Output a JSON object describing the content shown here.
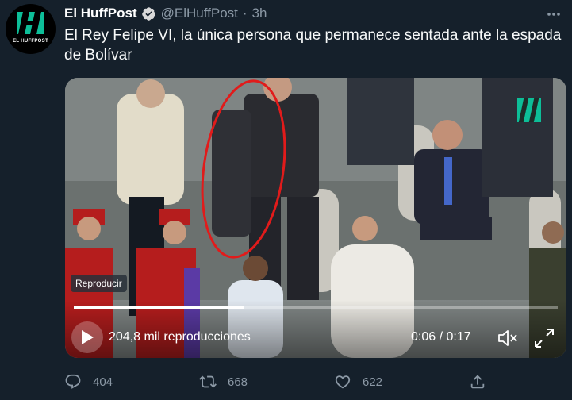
{
  "tweet": {
    "display_name": "El HuffPost",
    "handle": "@ElHuffPost",
    "separator": "·",
    "time_ago": "3h",
    "text": "El Rey Felipe VI, la única persona que permanece sentada ante la espada de Bolívar",
    "avatar_text": "EL HUFFPOST",
    "brand_color": "#0dbe98"
  },
  "video": {
    "badge": "Reproducir",
    "views": "204,8 mil reproducciones",
    "time": "0:06 / 0:17",
    "progress": 0.353
  },
  "actions": {
    "replies": "404",
    "retweets": "668",
    "likes": "622"
  }
}
